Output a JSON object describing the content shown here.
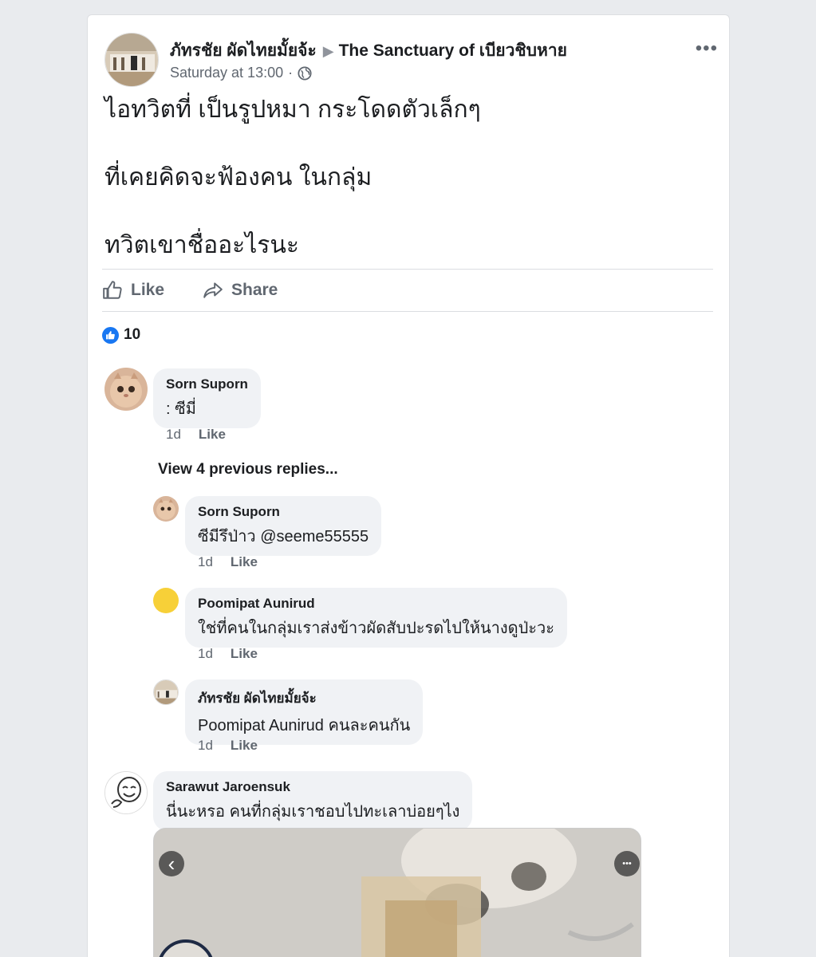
{
  "post": {
    "author": "ภัทรชัย ผัดไทยมั้ยจ้ะ",
    "separator_arrow": "▶",
    "group": "The Sanctuary of เบียวชิบหาย",
    "time": "Saturday at 13:00",
    "dot": "·",
    "more_label": "•••",
    "lines": [
      "ไอทวิตที่ เป็นรูปหมา กระโดดตัวเล็กๆ",
      "ที่เคยคิดจะฟ้องคน ในกลุ่ม",
      "ทวิตเขาชื่ออะไรนะ"
    ]
  },
  "actions": {
    "like": "Like",
    "share": "Share"
  },
  "reactions": {
    "count": "10"
  },
  "comments": {
    "c1": {
      "name": "Sorn Suporn",
      "text": ": ซีมี่",
      "time": "1d",
      "like": "Like"
    },
    "view_more": "View 4 previous replies...",
    "r1": {
      "name": "Sorn Suporn",
      "text": "ซีมีรึป่าว @seeme55555",
      "time": "1d",
      "like": "Like"
    },
    "r2": {
      "name": "Poomipat Aunirud",
      "text": "ใช่ที่คนในกลุ่มเราส่งข้าวผัดสับปะรดไปให้นางดูป่ะวะ",
      "time": "1d",
      "like": "Like"
    },
    "r3": {
      "name": "ภัทรชัย ผัดไทยมั้ยจ้ะ",
      "tag": "Poomipat Aunirud",
      "text": " คนละคนกัน",
      "time": "1d",
      "like": "Like"
    },
    "c2": {
      "name": "Sarawut Jaroensuk",
      "text": "นี่นะหรอ คนที่กลุ่มเราชอบไปทะเลาบ่อยๆไง"
    }
  },
  "attachment": {
    "prev_symbol": "‹",
    "more_symbol": "•••"
  },
  "colors": {
    "accent": "#1877f2",
    "bubble": "#f0f2f5",
    "secondary_text": "#606770",
    "yellow_avatar": "#f7d038"
  }
}
